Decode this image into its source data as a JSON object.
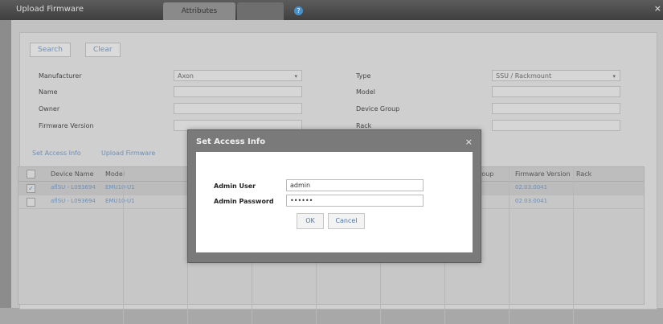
{
  "window": {
    "title": "Upload Firmware",
    "tab_label": "Attributes",
    "help_glyph": "?",
    "close_glyph": "×"
  },
  "search": {
    "search_label": "Search",
    "clear_label": "Clear"
  },
  "filters": {
    "manufacturer_label": "Manufacturer",
    "manufacturer_value": "Axon",
    "name_label": "Name",
    "owner_label": "Owner",
    "firmware_version_label": "Firmware Version",
    "type_label": "Type",
    "type_value": "SSU / Rackmount",
    "model_label": "Model",
    "device_group_label": "Device Group",
    "rack_label": "Rack"
  },
  "actions": {
    "set_access_info": "Set Access Info",
    "upload_firmware": "Upload Firmware"
  },
  "table": {
    "headers": {
      "device_name": "Device Name",
      "model": "Model",
      "group": "Group",
      "firmware_version": "Firmware Version",
      "rack": "Rack"
    },
    "rows": [
      {
        "checked": true,
        "device_name": "aflSU - L093694",
        "model": "EMU10-U1",
        "firmware_version": "02.03.0041"
      },
      {
        "checked": false,
        "device_name": "aflSU - L093694",
        "model": "EMU10-U1",
        "firmware_version": "02.03.0041"
      }
    ]
  },
  "dialog": {
    "title": "Set Access Info",
    "close_glyph": "×",
    "admin_user_label": "Admin User",
    "admin_user_value": "admin",
    "admin_password_label": "Admin Password",
    "admin_password_value": "••••••",
    "ok_label": "OK",
    "cancel_label": "Cancel"
  },
  "checkmark_glyph": "✓",
  "dropdown_glyph": "▾"
}
